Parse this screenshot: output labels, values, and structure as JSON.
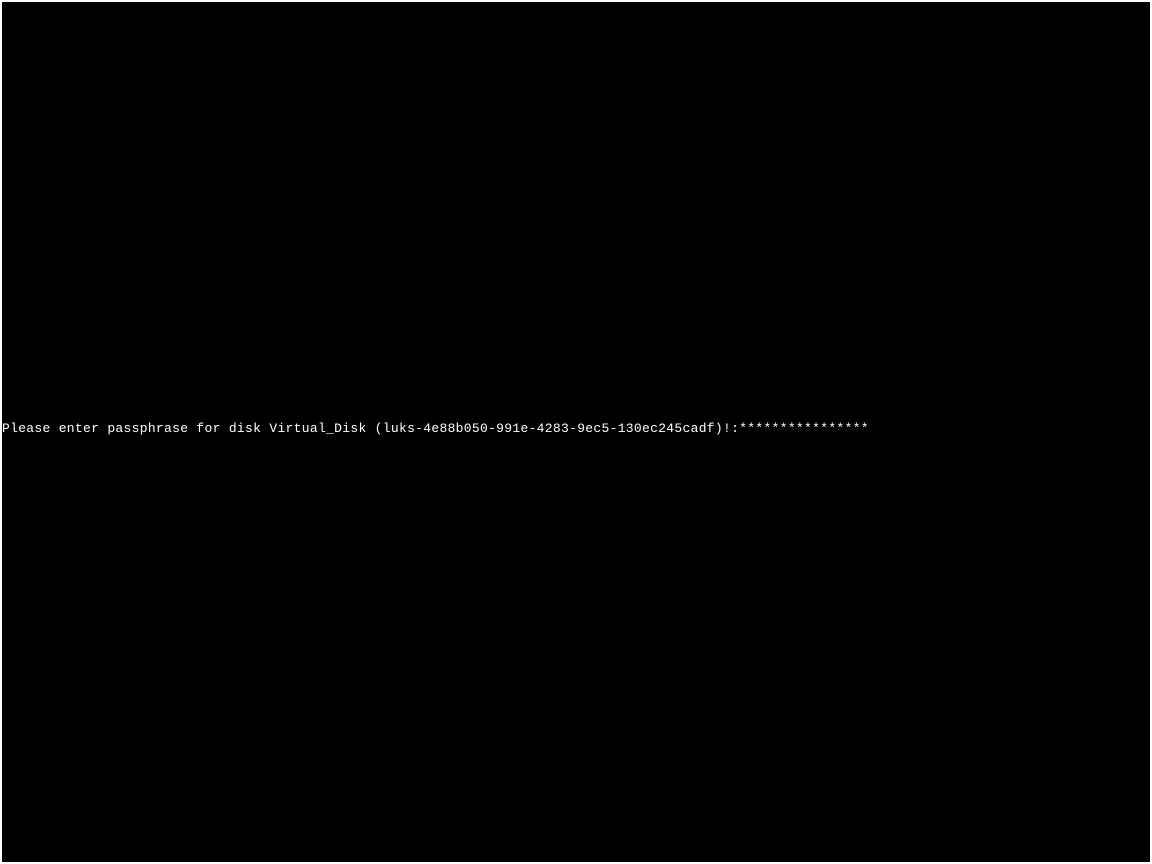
{
  "prompt": {
    "text": "Please enter passphrase for disk Virtual_Disk (luks-4e88b050-991e-4283-9ec5-130ec245cadf)!:",
    "masked_input": "****************"
  }
}
